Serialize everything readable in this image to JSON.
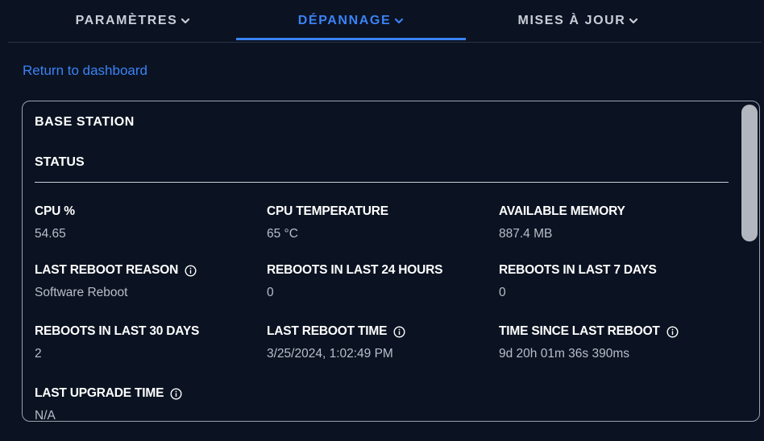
{
  "tabs": [
    {
      "label": "PARAMÈTRES",
      "active": false
    },
    {
      "label": "DÉPANNAGE",
      "active": true
    },
    {
      "label": "MISES À JOUR",
      "active": false
    }
  ],
  "return_link": "Return to dashboard",
  "panel": {
    "title": "BASE STATION",
    "section": "STATUS",
    "metrics": [
      {
        "label": "CPU %",
        "value": "54.65",
        "info": false
      },
      {
        "label": "CPU TEMPERATURE",
        "value": "65 °C",
        "info": false
      },
      {
        "label": "AVAILABLE MEMORY",
        "value": "887.4 MB",
        "info": false
      },
      {
        "label": "LAST REBOOT REASON",
        "value": "Software Reboot",
        "info": true
      },
      {
        "label": "REBOOTS IN LAST 24 HOURS",
        "value": "0",
        "info": false
      },
      {
        "label": "REBOOTS IN LAST 7 DAYS",
        "value": "0",
        "info": false
      },
      {
        "label": "REBOOTS IN LAST 30 DAYS",
        "value": "2",
        "info": false
      },
      {
        "label": "LAST REBOOT TIME",
        "value": "3/25/2024, 1:02:49 PM",
        "info": true
      },
      {
        "label": "TIME SINCE LAST REBOOT",
        "value": "9d 20h 01m 36s 390ms",
        "info": true
      },
      {
        "label": "LAST UPGRADE TIME",
        "value": "N/A",
        "info": true
      }
    ]
  },
  "colors": {
    "background": "#0b1322",
    "accent": "#3b82f6",
    "text": "#ffffff",
    "muted": "#b8bec9"
  },
  "icons": {
    "tab_chevron": "chevron-down-icon",
    "info": "info-icon"
  }
}
